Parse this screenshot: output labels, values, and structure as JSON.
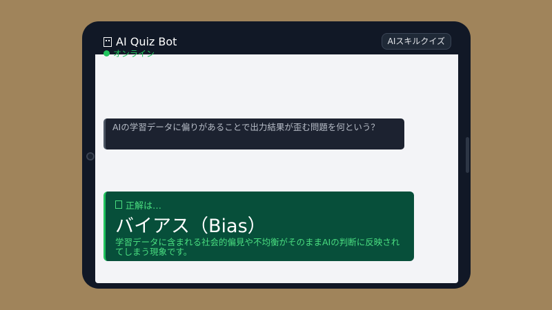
{
  "header": {
    "title": "AI Quiz Bot",
    "status": "オンライン",
    "quiz_button_label": "AIスキルクイズ"
  },
  "question": {
    "text": "AIの学習データに偏りがあることで出力結果が歪む問題を何という？"
  },
  "answer": {
    "heading": "正解は…",
    "term": "バイアス（Bias）",
    "description": "学習データに含まれる社会的偏見や不均衡がそのままAIの判断に反映されてしまう現象です。"
  },
  "colors": {
    "background": "#a0845b",
    "device": "#111826",
    "screen": "#f3f4f7",
    "accent": "#22c55e",
    "answer_bg": "#074f3a"
  },
  "icons": {
    "title_icon": "robot-icon",
    "answer_icon": "sparkle-icon",
    "status_icon": "online-dot-icon"
  }
}
